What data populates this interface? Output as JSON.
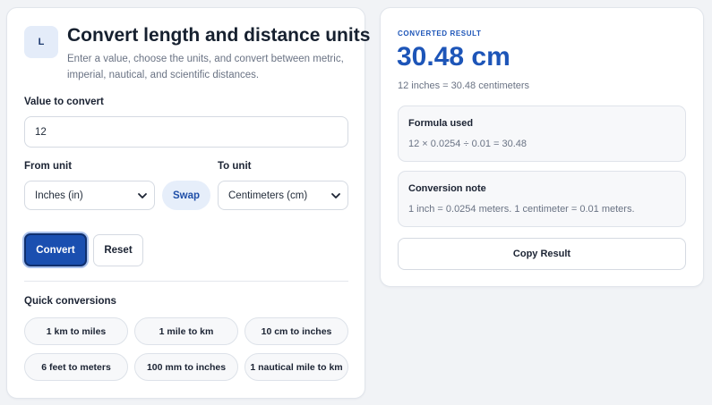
{
  "header": {
    "logo_letter": "L",
    "title": "Convert length and distance units",
    "subtitle": "Enter a value, choose the units, and convert between metric, imperial, nautical, and scientific distances."
  },
  "form": {
    "value_label": "Value to convert",
    "value": "12",
    "from_label": "From unit",
    "from_value": "Inches (in)",
    "to_label": "To unit",
    "to_value": "Centimeters (cm)",
    "swap_label": "Swap",
    "convert_label": "Convert",
    "reset_label": "Reset"
  },
  "quick": {
    "title": "Quick conversions",
    "items": [
      "1 km to miles",
      "1 mile to km",
      "10 cm to inches",
      "6 feet to meters",
      "100 mm to inches",
      "1 nautical mile to km"
    ]
  },
  "result": {
    "eyebrow": "CONVERTED RESULT",
    "value": "30.48 cm",
    "summary": "12 inches = 30.48 centimeters",
    "formula_title": "Formula used",
    "formula": "12 × 0.0254 ÷ 0.01 = 30.48",
    "note_title": "Conversion note",
    "note": "1 inch = 0.0254 meters. 1 centimeter = 0.01 meters.",
    "copy_label": "Copy Result"
  },
  "colors": {
    "accent": "#1d55b8",
    "primary_button": "#1a4fb0",
    "swap_bg": "#e6eefa"
  }
}
